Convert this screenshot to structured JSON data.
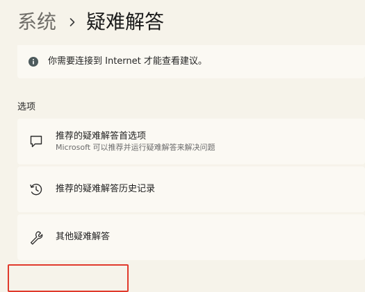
{
  "breadcrumb": {
    "parent": "系统",
    "current": "疑难解答"
  },
  "notice": {
    "icon": "info-icon",
    "text": "你需要连接到 Internet 才能查看建议。"
  },
  "options_section": {
    "label": "选项",
    "items": [
      {
        "icon": "chat-bubble-icon",
        "title": "推荐的疑难解答首选项",
        "subtitle": "Microsoft 可以推荐并运行疑难解答来解决问题"
      },
      {
        "icon": "history-icon",
        "title": "推荐的疑难解答历史记录"
      },
      {
        "icon": "wrench-icon",
        "title": "其他疑难解答"
      }
    ]
  },
  "colors": {
    "background": "#f6f3ea",
    "card": "#fbf9f3",
    "highlight": "#e0392b"
  }
}
